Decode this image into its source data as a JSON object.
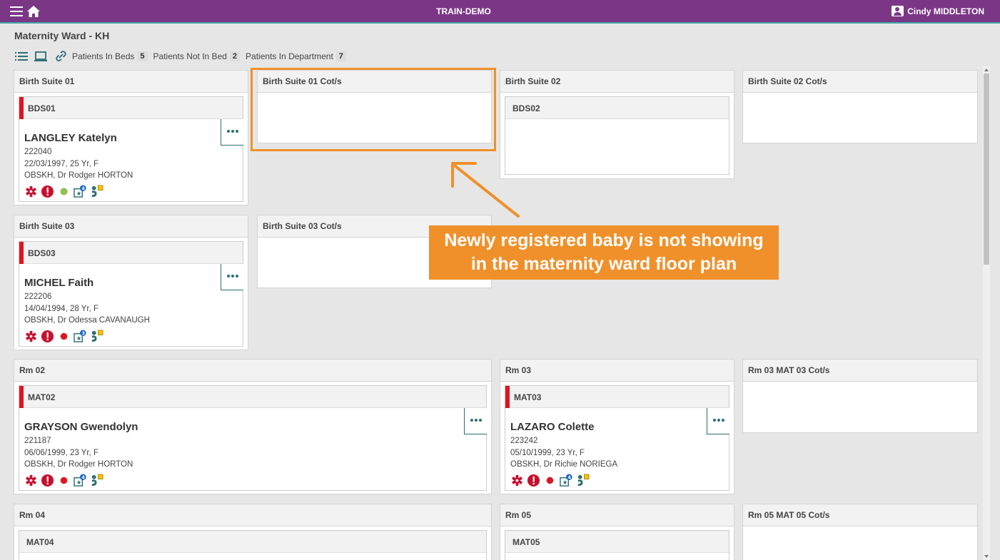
{
  "header": {
    "env_title": "TRAIN-DEMO",
    "user_name": "Cindy MIDDLETON",
    "bg_color": "#7b3786"
  },
  "page": {
    "title": "Maternity Ward - KH"
  },
  "toolbar": {
    "patients_in_beds_label": "Patients In Beds",
    "patients_in_beds_count": "5",
    "patients_not_in_bed_label": "Patients Not In Bed",
    "patients_not_in_bed_count": "2",
    "patients_in_department_label": "Patients In Department",
    "patients_in_department_count": "7"
  },
  "rooms": {
    "bs01": {
      "name": "Birth Suite 01",
      "bed": "BDS01",
      "patient": {
        "name": "LANGLEY Katelyn",
        "mrn": "222040",
        "dob": "22/03/1997, 25 Yr, F",
        "clinic": "OBSKH, Dr Rodger HORTON",
        "status_color": "#8dc63f",
        "badge": "4"
      }
    },
    "bs01cot": {
      "name": "Birth Suite 01 Cot/s"
    },
    "bs02": {
      "name": "Birth Suite 02",
      "bed": "BDS02"
    },
    "bs02cot": {
      "name": "Birth Suite 02 Cot/s"
    },
    "bs03": {
      "name": "Birth Suite 03",
      "bed": "BDS03",
      "patient": {
        "name": "MICHEL Faith",
        "mrn": "222206",
        "dob": "14/04/1994, 28 Yr, F",
        "clinic": "OBSKH, Dr Odessa CAVANAUGH",
        "status_color": "#e3131e",
        "badge": "3"
      }
    },
    "bs03cot": {
      "name": "Birth Suite 03 Cot/s"
    },
    "rm02": {
      "name": "Rm 02",
      "bed": "MAT02",
      "patient": {
        "name": "GRAYSON Gwendolyn",
        "mrn": "221187",
        "dob": "06/06/1999, 23 Yr, F",
        "clinic": "OBSKH, Dr Rodger HORTON",
        "status_color": "#e3131e",
        "badge": "4"
      }
    },
    "rm03": {
      "name": "Rm 03",
      "bed": "MAT03",
      "patient": {
        "name": "LAZARO Colette",
        "mrn": "223242",
        "dob": "05/10/1999, 23 Yr, F",
        "clinic": "OBSKH, Dr Richie NORIEGA",
        "status_color": "#e3131e",
        "badge": "4"
      }
    },
    "rm03cot": {
      "name": "Rm 03 MAT 03 Cot/s"
    },
    "rm04": {
      "name": "Rm 04",
      "bed": "MAT04"
    },
    "rm05": {
      "name": "Rm 05",
      "bed": "MAT05"
    },
    "rm05cot": {
      "name": "Rm 05 MAT 05 Cot/s"
    }
  },
  "annotation": {
    "callout_line1": "Newly registered baby is not showing",
    "callout_line2": "in the maternity ward floor plan",
    "color": "#f0902a"
  }
}
